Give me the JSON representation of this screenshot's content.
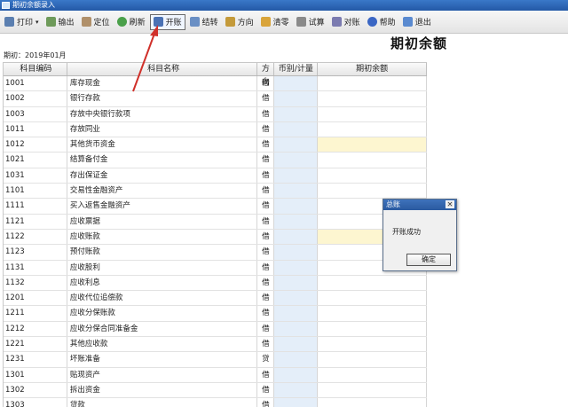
{
  "window": {
    "title": "期初余额录入"
  },
  "toolbar": {
    "buttons": [
      {
        "label": "打印",
        "icon": "printer-icon",
        "color": "#5b7fb0"
      },
      {
        "label": "输出",
        "icon": "export-icon",
        "color": "#6e9a5a"
      },
      {
        "label": "定位",
        "icon": "locate-icon",
        "color": "#b0906a"
      },
      {
        "label": "刷新",
        "icon": "refresh-icon",
        "color": "#4aa04a"
      },
      {
        "label": "开账",
        "icon": "open-ledger-icon",
        "color": "#4a72b4"
      },
      {
        "label": "结转",
        "icon": "carryover-icon",
        "color": "#6a8fc4"
      },
      {
        "label": "方向",
        "icon": "direction-icon",
        "color": "#c49a3a"
      },
      {
        "label": "清零",
        "icon": "clear-icon",
        "color": "#d9a43a"
      },
      {
        "label": "试算",
        "icon": "calculator-icon",
        "color": "#8a8a8a"
      },
      {
        "label": "对账",
        "icon": "reconcile-icon",
        "color": "#7b7bb0"
      },
      {
        "label": "帮助",
        "icon": "help-icon",
        "color": "#3a66c4"
      },
      {
        "label": "退出",
        "icon": "exit-icon",
        "color": "#5a8ad0"
      }
    ],
    "active_label": "开账"
  },
  "page": {
    "title": "期初余额",
    "period": "期初：2019年01月"
  },
  "table": {
    "headers": [
      "科目编码",
      "科目名称",
      "方向",
      "币别/计量",
      "期初余额"
    ],
    "rows": [
      [
        "1001",
        "库存现金",
        "借"
      ],
      [
        "1002",
        "银行存款",
        "借"
      ],
      [
        "1003",
        "存放中央银行款项",
        "借"
      ],
      [
        "1011",
        "存放同业",
        "借"
      ],
      [
        "1012",
        "其他货币资金",
        "借"
      ],
      [
        "1021",
        "结算备付金",
        "借"
      ],
      [
        "1031",
        "存出保证金",
        "借"
      ],
      [
        "1101",
        "交易性金融资产",
        "借"
      ],
      [
        "1111",
        "买入返售金融资产",
        "借"
      ],
      [
        "1121",
        "应收票据",
        "借"
      ],
      [
        "1122",
        "应收账款",
        "借"
      ],
      [
        "1123",
        "预付账款",
        "借"
      ],
      [
        "1131",
        "应收股利",
        "借"
      ],
      [
        "1132",
        "应收利息",
        "借"
      ],
      [
        "1201",
        "应收代位追偿款",
        "借"
      ],
      [
        "1211",
        "应收分保账款",
        "借"
      ],
      [
        "1212",
        "应收分保合同准备金",
        "借"
      ],
      [
        "1221",
        "其他应收款",
        "借"
      ],
      [
        "1231",
        "坏账准备",
        "贷"
      ],
      [
        "1301",
        "贴现资产",
        "借"
      ],
      [
        "1302",
        "拆出资金",
        "借"
      ],
      [
        "1303",
        "贷款",
        "借"
      ]
    ]
  },
  "dialog": {
    "title": "总账",
    "message": "开账成功",
    "ok_label": "确定"
  },
  "colors": {
    "arrow": "#d0302a",
    "currency_col": "#e4eef9",
    "highlight": "#fdf6d0"
  }
}
